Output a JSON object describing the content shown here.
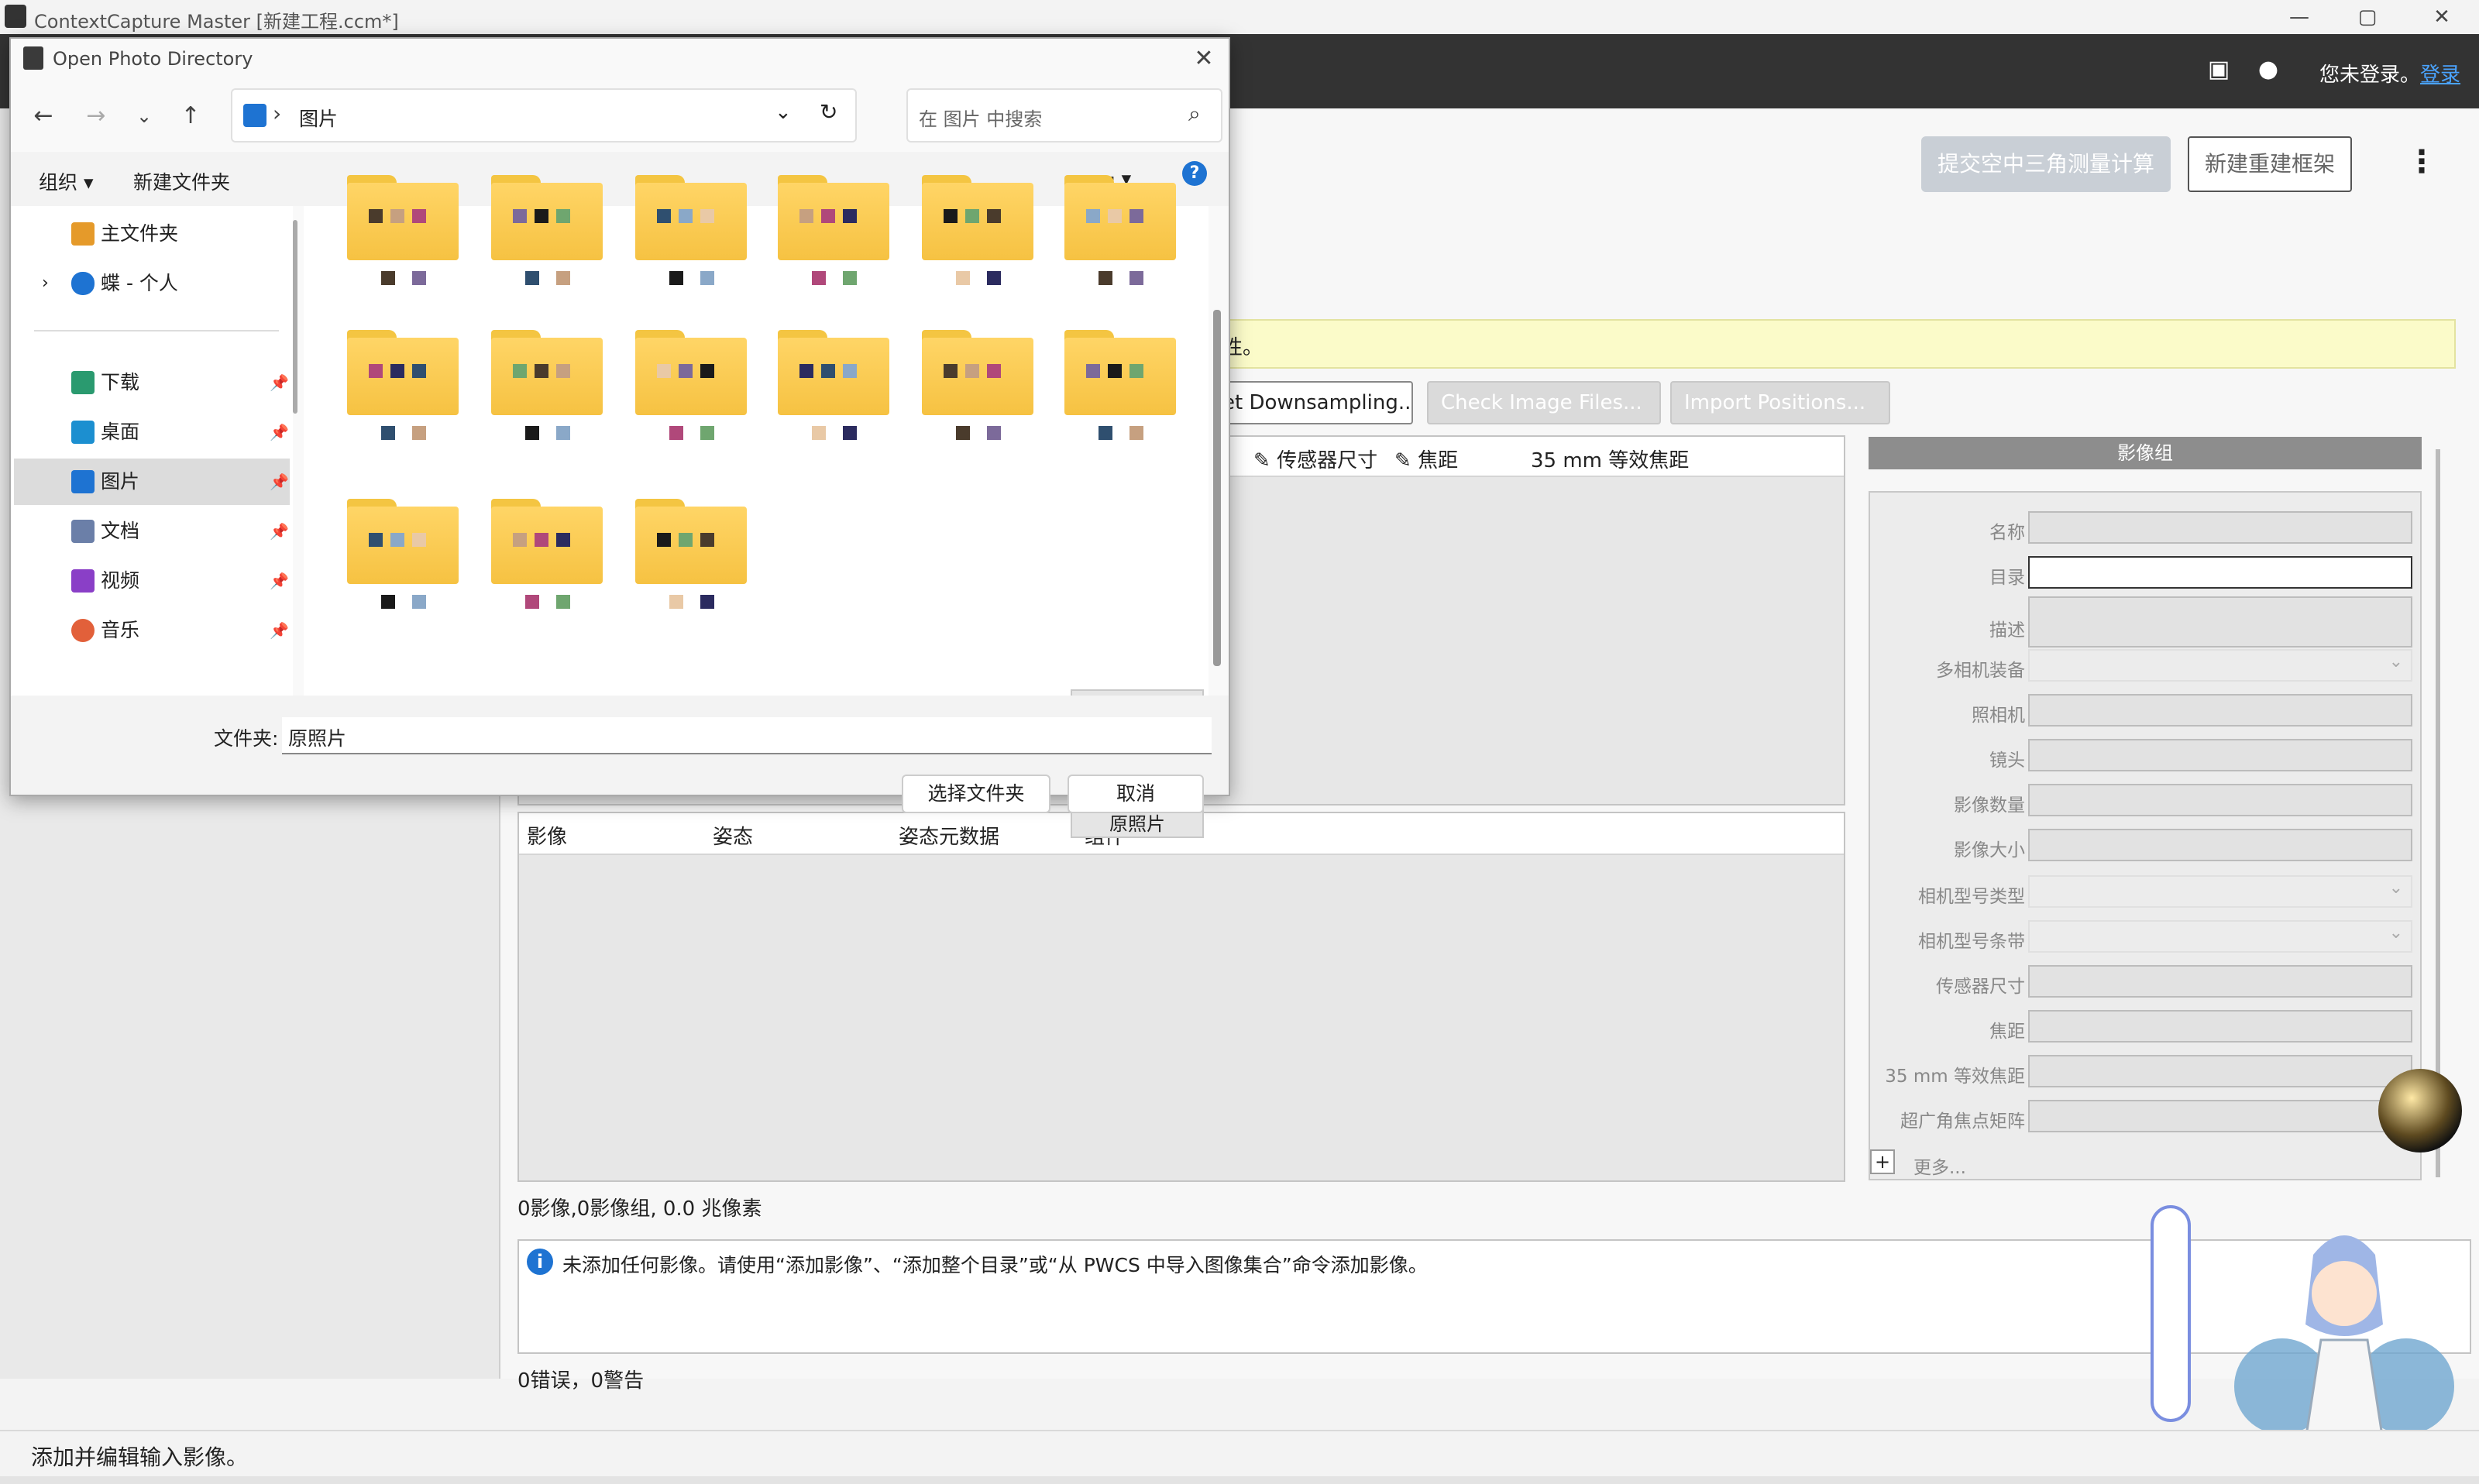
{
  "window": {
    "title": "ContextCapture Master [新建工程.ccm*]",
    "minimize": "—",
    "maximize": "▢",
    "close": "✕"
  },
  "toolbar": {
    "login_text": "您未登录。",
    "login_link": "登录",
    "save_icon": "save-icon",
    "tip_icon": "lightbulb-icon",
    "menu_icon": "⋮"
  },
  "main": {
    "submit_button": "提交空中三角测量计算",
    "new_frame_button": "新建重建框架",
    "notice_text": "性。",
    "actions": [
      "et Downsampling...",
      "Check Image Files...",
      "Import Positions..."
    ],
    "photo_table_headers": [
      "传感器尺寸",
      "焦距",
      "35 mm 等效焦距"
    ],
    "image_table_headers": [
      "影像",
      "姿态",
      "姿态元数据",
      "组件"
    ],
    "summary": "0影像,0影像组, 0.0 兆像素",
    "info_message": "未添加任何影像。请使用“添加影像”、“添加整个目录”或“从 PWCS 中导入图像集合”命令添加影像。",
    "errors": "0错误，0警告"
  },
  "props": {
    "header": "影像组",
    "labels": [
      "名称",
      "目录",
      "描述",
      "多相机装备",
      "照相机",
      "镜头",
      "影像数量",
      "影像大小",
      "相机型号类型",
      "相机型号条带",
      "传感器尺寸",
      "焦距",
      "35 mm 等效焦距",
      "超广角焦点矩阵"
    ],
    "more": "更多...",
    "more_button": "+"
  },
  "status_bar": "添加并编辑输入影像。",
  "dialog": {
    "title": "Open Photo Directory",
    "breadcrumb": "图片",
    "search_placeholder": "在 图片 中搜索",
    "cmd_organize": "组织 ▾",
    "cmd_new_folder": "新建文件夹",
    "nav_items": [
      {
        "label": "主文件夹",
        "icon": "home-icon"
      },
      {
        "label": "蝶 - 个人",
        "icon": "onedrive-icon"
      },
      {
        "label": "下载",
        "icon": "download-icon"
      },
      {
        "label": "桌面",
        "icon": "desktop-icon"
      },
      {
        "label": "图片",
        "icon": "pictures-icon"
      },
      {
        "label": "文档",
        "icon": "documents-icon"
      },
      {
        "label": "视频",
        "icon": "videos-icon"
      },
      {
        "label": "音乐",
        "icon": "music-icon"
      }
    ],
    "selected_folder": "原照片",
    "folder_label": "文件夹:",
    "folder_value": "原照片",
    "select_button": "选择文件夹",
    "cancel_button": "取消"
  }
}
